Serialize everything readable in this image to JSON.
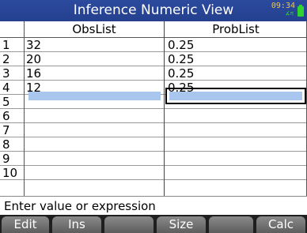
{
  "title": "Inference Numeric View",
  "status_bar": {
    "time": "09:34",
    "mode": "∡π",
    "battery_icon": "battery-icon"
  },
  "table": {
    "columns": [
      "ObsList",
      "ProbList"
    ],
    "row_numbers": [
      "1",
      "2",
      "3",
      "4",
      "5",
      "6",
      "7",
      "8",
      "9",
      "10"
    ],
    "rows": [
      [
        "32",
        "0.25"
      ],
      [
        "20",
        "0.25"
      ],
      [
        "16",
        "0.25"
      ],
      [
        "12",
        "0.25"
      ]
    ]
  },
  "prompt": "Enter value or expression",
  "menu": [
    "Edit",
    "Ins",
    "",
    "Size",
    "",
    "Calc"
  ],
  "colors": {
    "title_bar": "#2c4a9e",
    "selection": "#a9c7ee",
    "menu_bg": "#1f1f1f"
  }
}
